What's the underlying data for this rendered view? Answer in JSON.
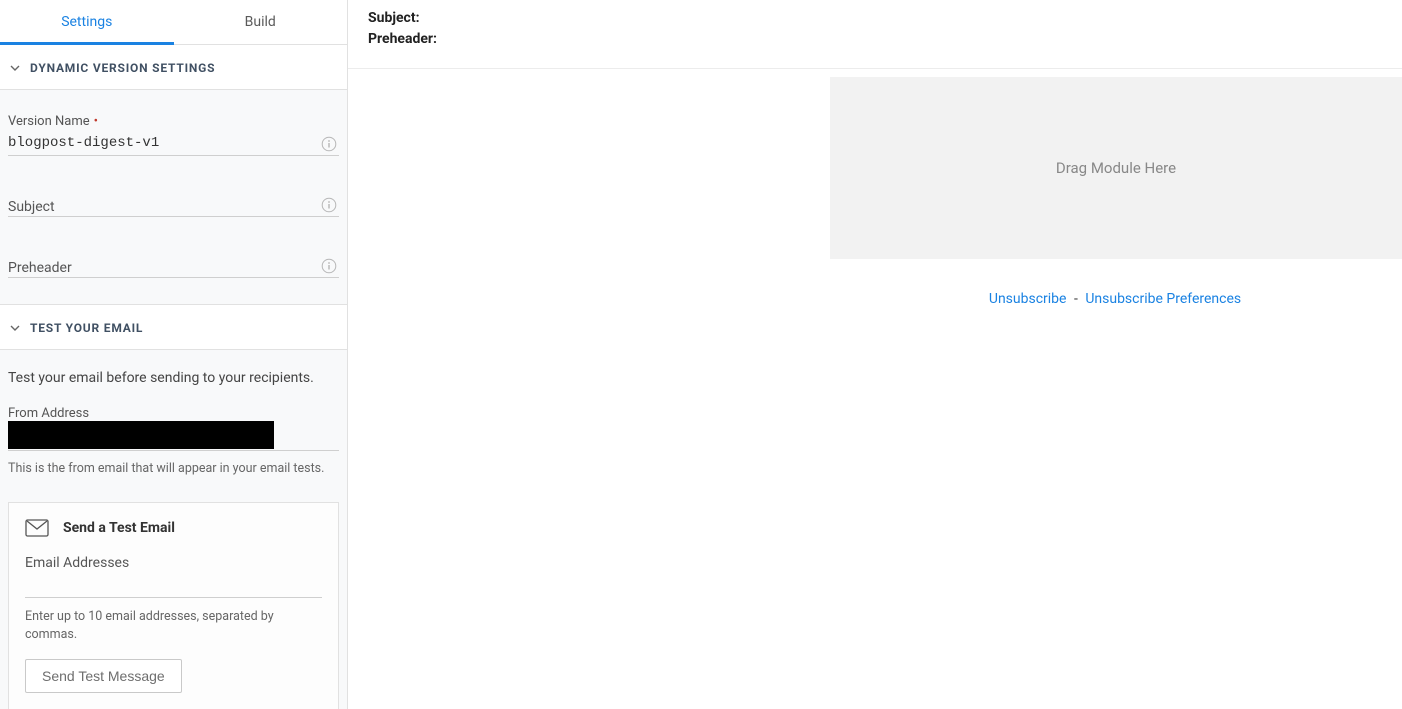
{
  "tabs": {
    "settings": "Settings",
    "build": "Build"
  },
  "sections": {
    "dynamic": {
      "title": "DYNAMIC VERSION SETTINGS",
      "version_name_label": "Version Name",
      "version_name_value": "blogpost-digest-v1",
      "subject_label": "Subject",
      "subject_value": "",
      "preheader_label": "Preheader",
      "preheader_value": ""
    },
    "test": {
      "title": "TEST YOUR EMAIL",
      "description": "Test your email before sending to your recipients.",
      "from_label": "From Address",
      "from_value": "",
      "from_hint": "This is the from email that will appear in your email tests.",
      "card_title": "Send a Test Email",
      "addresses_label": "Email Addresses",
      "addresses_value": "",
      "addresses_hint": "Enter up to 10 email addresses, separated by commas.",
      "send_button": "Send Test Message"
    }
  },
  "preview": {
    "subject_label": "Subject:",
    "preheader_label": "Preheader:",
    "dropzone_text": "Drag Module Here",
    "unsubscribe": "Unsubscribe",
    "separator": "-",
    "preferences": "Unsubscribe Preferences"
  }
}
